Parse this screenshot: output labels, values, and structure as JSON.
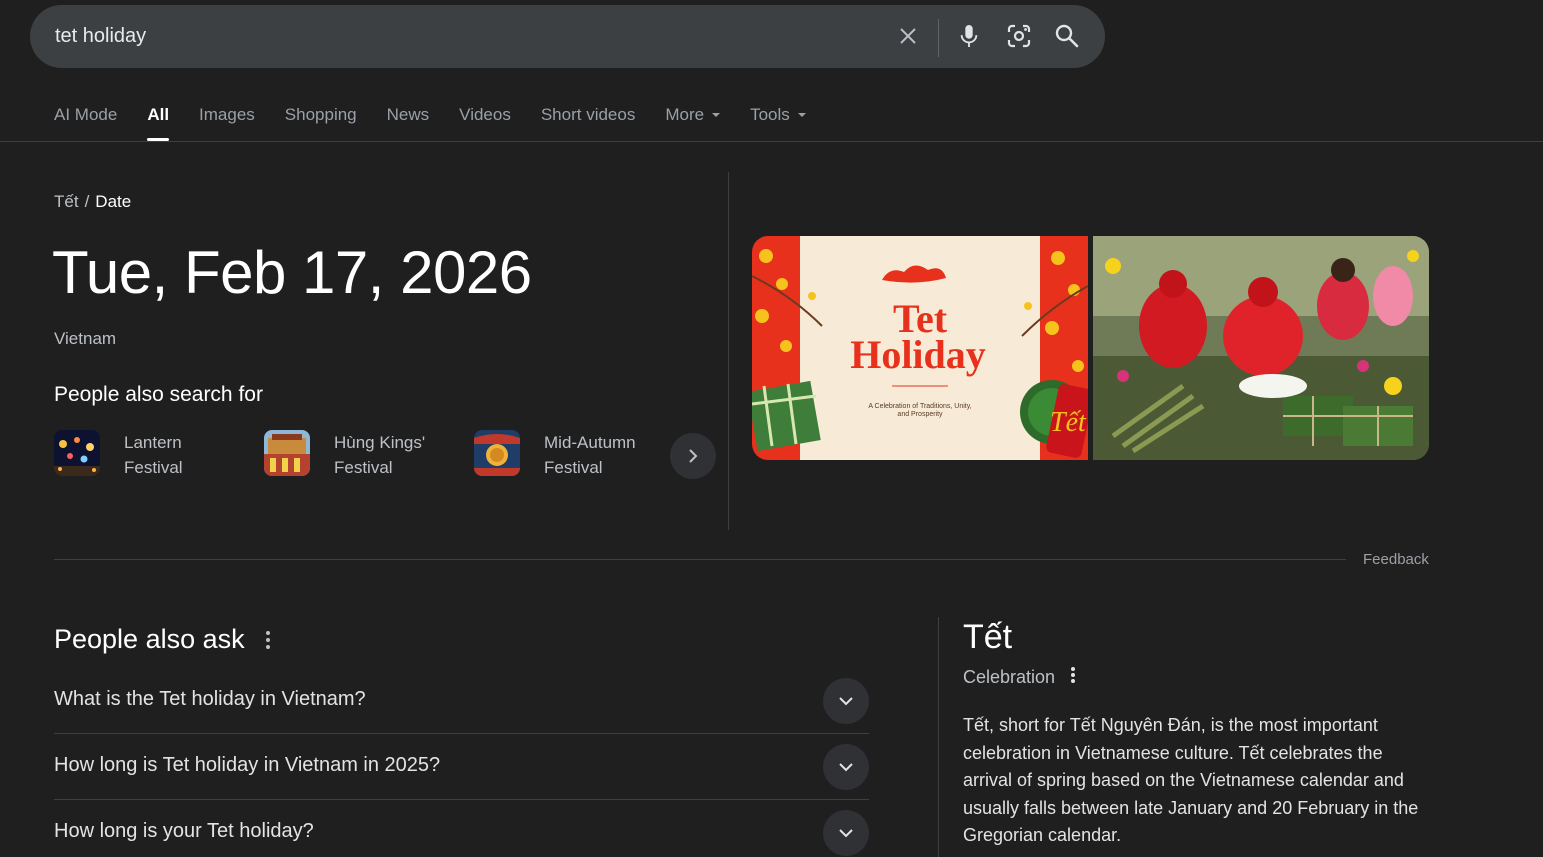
{
  "search": {
    "query": "tet holiday",
    "icons": [
      "clear-icon",
      "mic-icon",
      "lens-icon",
      "search-icon"
    ]
  },
  "tabs": [
    {
      "label": "AI Mode",
      "active": false
    },
    {
      "label": "All",
      "active": true
    },
    {
      "label": "Images",
      "active": false
    },
    {
      "label": "Shopping",
      "active": false
    },
    {
      "label": "News",
      "active": false
    },
    {
      "label": "Videos",
      "active": false
    },
    {
      "label": "Short videos",
      "active": false
    },
    {
      "label": "More",
      "active": false,
      "dropdown": true
    },
    {
      "label": "Tools",
      "active": false,
      "dropdown": true
    }
  ],
  "answer": {
    "breadcrumb_parent": "Tết",
    "breadcrumb_sep": "/",
    "breadcrumb_current": "Date",
    "date": "Tue, Feb 17, 2026",
    "country": "Vietnam",
    "pasf_title": "People also search for",
    "pasf": [
      {
        "line1": "Lantern",
        "line2": "Festival"
      },
      {
        "line1": "Hùng Kings'",
        "line2": "Festival"
      },
      {
        "line1": "Mid-Autumn",
        "line2": "Festival"
      }
    ],
    "image1_text": {
      "title1": "Tet",
      "title2": "Holiday",
      "caption1": "A Celebration of Traditions, Unity,",
      "caption2": "and Prosperity",
      "corner": "Tết"
    }
  },
  "feedback": "Feedback",
  "paa": {
    "title": "People also ask",
    "questions": [
      "What is the Tet holiday in Vietnam?",
      "How long is Tet holiday in Vietnam in 2025?",
      "How long is your Tet holiday?"
    ]
  },
  "knowledge_panel": {
    "title": "Tết",
    "subtitle": "Celebration",
    "description": "Tết, short for Tết Nguyên Đán, is the most important celebration in Vietnamese culture. Tết celebrates the arrival of spring based on the Vietnamese calendar and usually falls between late January and 20 February in the Gregorian calendar."
  },
  "colors": {
    "background": "#1f1f1f",
    "searchbar": "#3c4043",
    "tab_active": "#ffffff",
    "tab_inactive": "#9aa0a6",
    "festive_red": "#e8311c"
  }
}
